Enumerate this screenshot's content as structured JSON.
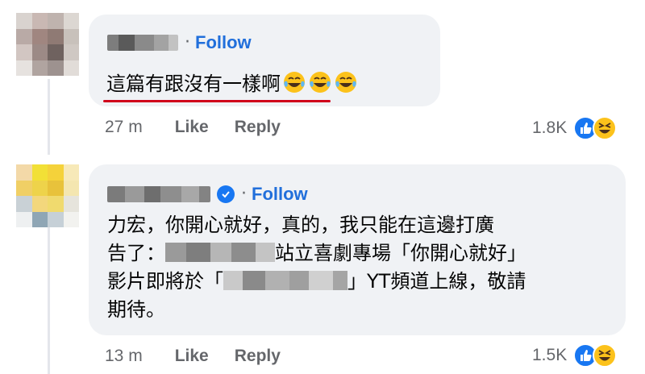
{
  "comments": [
    {
      "follow_label": "Follow",
      "text": "這篇有跟沒有一樣啊",
      "emojis": [
        "tears-of-joy-emoji",
        "tears-of-joy-emoji",
        "tears-of-joy-emoji"
      ],
      "time": "27 m",
      "like_label": "Like",
      "reply_label": "Reply",
      "reaction_count": "1.8K",
      "reaction_icons": [
        "like-reaction-icon",
        "haha-reaction-icon"
      ]
    },
    {
      "follow_label": "Follow",
      "verified": true,
      "text_line1": "力宏，你開心就好，真的，我只能在這邊打廣",
      "text_line2_pre": "告了：",
      "text_line2_post": "站立喜劇專場「你開心就好」",
      "text_line3_pre": "影片即將於「",
      "text_line3_post": "」YT頻道上線，敬請",
      "text_line4": "期待。",
      "time": "13 m",
      "like_label": "Like",
      "reply_label": "Reply",
      "reaction_count": "1.5K",
      "reaction_icons": [
        "like-reaction-icon",
        "haha-reaction-icon"
      ]
    }
  ],
  "colors": {
    "follow": "#216fdb",
    "bubble": "#f0f2f5",
    "meta": "#65676b",
    "underline": "#d0021b"
  }
}
